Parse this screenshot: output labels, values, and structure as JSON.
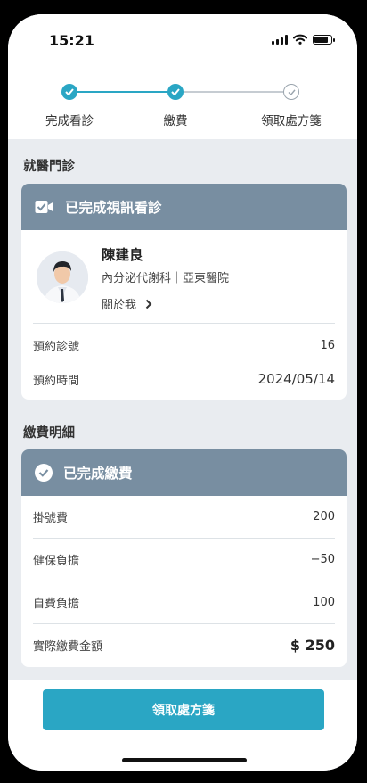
{
  "status": {
    "time": "15:21"
  },
  "steps": [
    {
      "label": "完成看診",
      "state": "done"
    },
    {
      "label": "繳費",
      "state": "done"
    },
    {
      "label": "領取處方箋",
      "state": "todo"
    }
  ],
  "visit": {
    "section_title": "就醫門診",
    "header": "已完成視訊看診",
    "doctor_name": "陳建良",
    "doctor_dept": "內分泌代謝科｜亞東醫院",
    "about_label": "關於我",
    "rows": [
      {
        "label": "預約診號",
        "value": "16"
      },
      {
        "label": "預約時間",
        "value": "2024/05/14"
      }
    ]
  },
  "payment": {
    "section_title": "繳費明細",
    "header": "已完成繳費",
    "rows": [
      {
        "label": "掛號費",
        "value": "200"
      },
      {
        "label": "健保負擔",
        "value": "−50"
      },
      {
        "label": "自費負擔",
        "value": "100"
      }
    ],
    "total_label": "實際繳費金額",
    "total_value": "$ 250"
  },
  "cta": {
    "label": "領取處方箋"
  },
  "colors": {
    "accent": "#2aa6c4",
    "header": "#788ea1",
    "background": "#e9ecf0"
  }
}
